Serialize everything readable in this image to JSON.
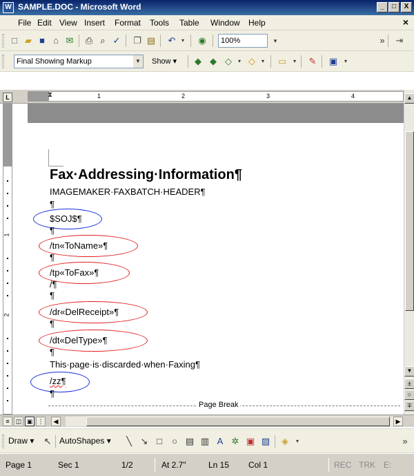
{
  "window": {
    "title": "SAMPLE.DOC - Microsoft Word",
    "app_icon": "W",
    "minimize": "_",
    "maximize": "□",
    "close": "X"
  },
  "menu": {
    "items": [
      "File",
      "Edit",
      "View",
      "Insert",
      "Format",
      "Tools",
      "Table",
      "Window",
      "Help"
    ],
    "close_doc": "×"
  },
  "standard_toolbar": {
    "zoom": "100%",
    "overflow": "»"
  },
  "reviewing_toolbar": {
    "display_mode": "Final Showing Markup",
    "show_label": "Show ▾"
  },
  "ruler": {
    "corner": "L",
    "h_numbers": [
      "1",
      "2",
      "3",
      "4"
    ],
    "v_numbers": [
      "1",
      "2"
    ]
  },
  "document": {
    "heading": "Fax·Addressing·Information¶",
    "subheading": "IMAGEMAKER·FAXBATCH·HEADER¶",
    "pilcrow": "¶",
    "soj": "$SOJ$¶",
    "tn": "/tn«ToName»¶",
    "tp": "/tp«ToFax»¶",
    "slash": "/¶",
    "dr": "/dr«DelReceipt»¶",
    "dt": "/dt«DelType»¶",
    "discard_note": "This·page·is·discarded·when·Faxing¶",
    "zz": "/zz¶",
    "page_break": "Page Break"
  },
  "drawing_toolbar": {
    "draw": "Draw ▾",
    "autoshapes": "AutoShapes ▾"
  },
  "status": {
    "page": "Page 1",
    "sec": "Sec 1",
    "pages": "1/2",
    "at": "At 2.7\"",
    "ln": "Ln 15",
    "col": "Col 1",
    "rec": "REC",
    "trk": "TRK",
    "ext": "E:"
  },
  "colors": {
    "blue_ellipse": "#1a2ed8",
    "red_ellipse": "#e01c1c",
    "title_bar": "#0a246a"
  }
}
